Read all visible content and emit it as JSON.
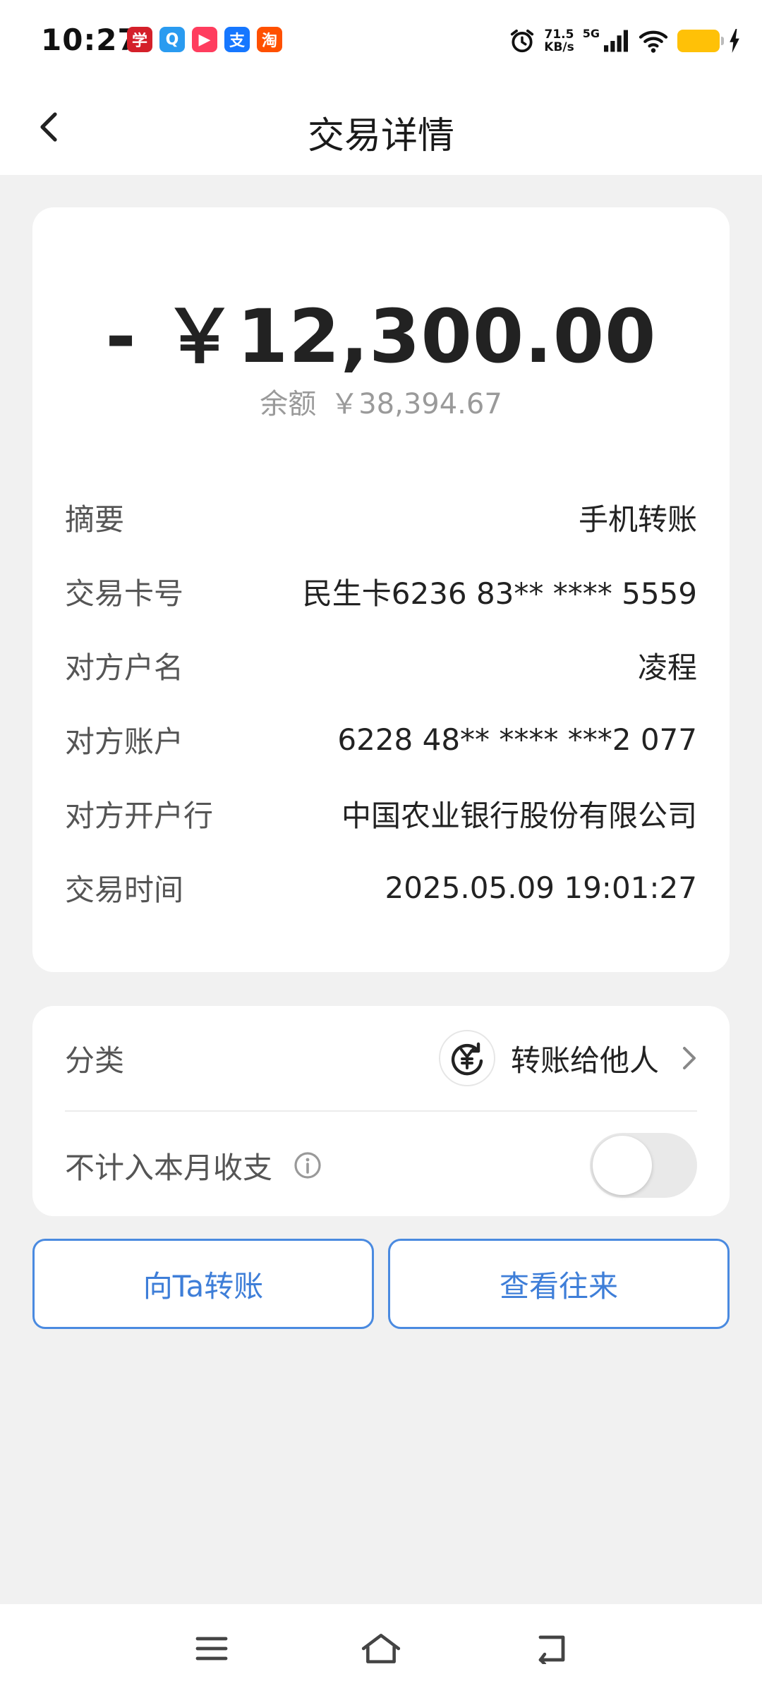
{
  "status_bar": {
    "time": "10:27",
    "net_speed_value": "71.5",
    "net_speed_unit": "KB/s",
    "network_type": "5G",
    "app_icons": [
      "学习强国",
      "QQ浏览器",
      "视频",
      "支付宝",
      "淘宝"
    ],
    "app_glyphs": [
      "学",
      "Q",
      "▶",
      "支",
      "淘"
    ]
  },
  "header": {
    "title": "交易详情"
  },
  "transaction": {
    "amount": "- ￥12,300.00",
    "balance_label": "余额",
    "balance_value": "￥38,394.67",
    "details": [
      {
        "label": "摘要",
        "value": "手机转账"
      },
      {
        "label": "交易卡号",
        "value": "民生卡6236 83** **** 5559"
      },
      {
        "label": "对方户名",
        "value": "凌程"
      },
      {
        "label": "对方账户",
        "value": "6228 48** **** ***2 077"
      },
      {
        "label": "对方开户行",
        "value": "中国农业银行股份有限公司"
      },
      {
        "label": "交易时间",
        "value": "2025.05.09 19:01:27"
      }
    ]
  },
  "category": {
    "label": "分类",
    "value": "转账给他人",
    "exclude_label": "不计入本月收支",
    "exclude_toggle_on": false
  },
  "actions": {
    "transfer_label": "向Ta转账",
    "history_label": "查看往来"
  },
  "colors": {
    "accent": "#3e7ed8",
    "background": "#f1f1f1",
    "battery": "#ffc107"
  }
}
